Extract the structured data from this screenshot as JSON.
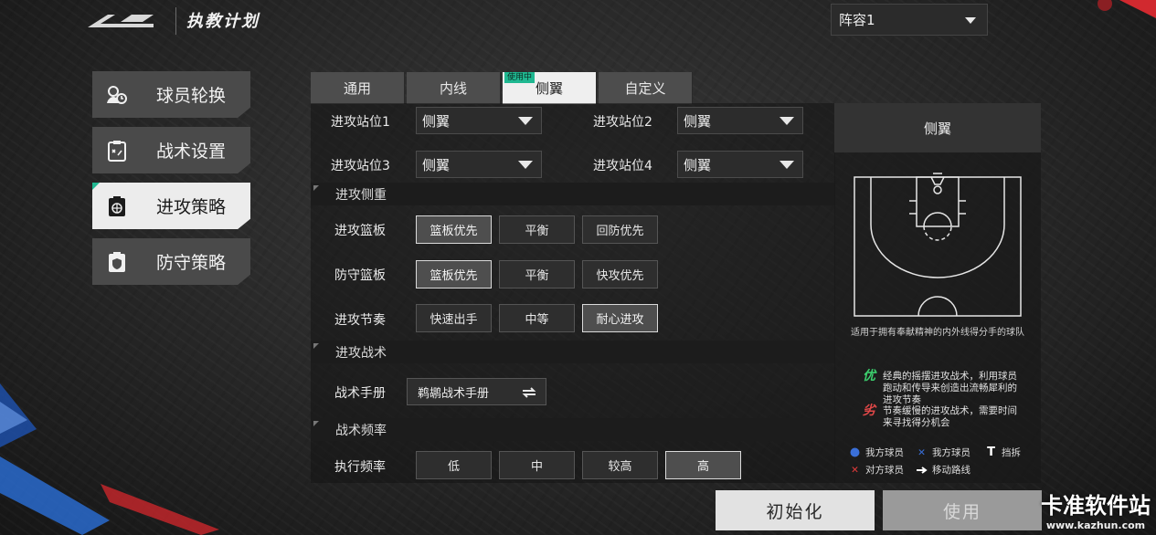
{
  "header": {
    "title": "执教计划",
    "lineup": {
      "selected": "阵容1"
    }
  },
  "nav": {
    "items": [
      {
        "label": "球员轮换",
        "icon": "player-rotation-icon",
        "active": false
      },
      {
        "label": "战术设置",
        "icon": "tactic-board-icon",
        "active": false
      },
      {
        "label": "进攻策略",
        "icon": "basketball-clipboard-icon",
        "active": true
      },
      {
        "label": "防守策略",
        "icon": "shield-clipboard-icon",
        "active": false
      }
    ]
  },
  "tabs": [
    {
      "label": "通用",
      "active": false
    },
    {
      "label": "内线",
      "active": false
    },
    {
      "label": "侧翼",
      "active": true,
      "badge": "使用中"
    },
    {
      "label": "自定义",
      "active": false
    }
  ],
  "positions": [
    {
      "label": "进攻站位1",
      "value": "侧翼"
    },
    {
      "label": "进攻站位2",
      "value": "侧翼"
    },
    {
      "label": "进攻站位3",
      "value": "侧翼"
    },
    {
      "label": "进攻站位4",
      "value": "侧翼"
    }
  ],
  "sections": {
    "emphasis": "进攻侧重",
    "tactics": "进攻战术",
    "frequency": "战术频率"
  },
  "emphasis_rows": [
    {
      "label": "进攻篮板",
      "options": [
        "篮板优先",
        "平衡",
        "回防优先"
      ],
      "selected": 0
    },
    {
      "label": "防守篮板",
      "options": [
        "篮板优先",
        "平衡",
        "快攻优先"
      ],
      "selected": 0
    },
    {
      "label": "进攻节奏",
      "options": [
        "快速出手",
        "中等",
        "耐心进攻"
      ],
      "selected": 2
    }
  ],
  "tactics_row": {
    "label": "战术手册",
    "value": "鹈鹕战术手册"
  },
  "frequency_row": {
    "label": "执行频率",
    "options": [
      "低",
      "中",
      "较高",
      "高"
    ],
    "selected": 3
  },
  "info": {
    "title": "侧翼",
    "caption": "适用于拥有奉献精神的内外线得分手的球队",
    "pro_tag": "优",
    "pro_text": "经典的摇摆进攻战术，利用球员跑动和传导来创造出流畅犀利的进攻节奏",
    "con_tag": "劣",
    "con_text": "节奏缓慢的进攻战术，需要时间来寻找得分机会",
    "legend": [
      {
        "label": "我方球员",
        "icon": "dot-icon",
        "color": "#3a6fd8"
      },
      {
        "label": "我方球员",
        "icon": "x-blue-icon",
        "color": "#3a6fd8"
      },
      {
        "label": "挡拆",
        "icon": "screen-t-icon",
        "color": "#ffffff"
      },
      {
        "label": "对方球员",
        "icon": "x-red-icon",
        "color": "#e03a3a"
      },
      {
        "label": "移动路线",
        "icon": "arrow-icon",
        "color": "#ffffff"
      }
    ]
  },
  "buttons": {
    "reset": "初始化",
    "use": "使用"
  },
  "watermark": {
    "title": "卡准软件站",
    "url": "www.kazhun.com"
  },
  "colors": {
    "accent": "#1fb891",
    "pro": "#3ccf6e",
    "con": "#e04848"
  }
}
